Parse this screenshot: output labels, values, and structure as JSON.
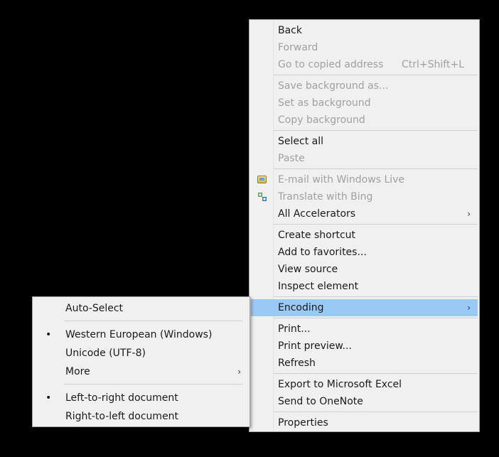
{
  "main_menu": {
    "back": "Back",
    "forward": "Forward",
    "go_to_copied_address": "Go to copied address",
    "go_to_copied_address_shortcut": "Ctrl+Shift+L",
    "save_background_as": "Save background as...",
    "set_as_background": "Set as background",
    "copy_background": "Copy background",
    "select_all": "Select all",
    "paste": "Paste",
    "email_with_windows_live": "E-mail with Windows Live",
    "translate_with_bing": "Translate with Bing",
    "all_accelerators": "All Accelerators",
    "create_shortcut": "Create shortcut",
    "add_to_favorites": "Add to favorites...",
    "view_source": "View source",
    "inspect_element": "Inspect element",
    "encoding": "Encoding",
    "print": "Print...",
    "print_preview": "Print preview...",
    "refresh": "Refresh",
    "export_to_excel": "Export to Microsoft Excel",
    "send_to_onenote": "Send to OneNote",
    "properties": "Properties",
    "submenu_arrow": "›"
  },
  "encoding_submenu": {
    "auto_select": "Auto-Select",
    "western_european": "Western European (Windows)",
    "unicode_utf8": "Unicode (UTF-8)",
    "more": "More",
    "left_to_right": "Left-to-right document",
    "right_to_left": "Right-to-left document",
    "bullet": "•",
    "submenu_arrow": "›"
  },
  "colors": {
    "highlight": "#99c9f5",
    "disabled_text": "#a0a0a0",
    "menu_background": "#f0f0f0"
  },
  "icons": {
    "email": "email-windows-live-icon",
    "translate": "translate-bing-icon"
  }
}
